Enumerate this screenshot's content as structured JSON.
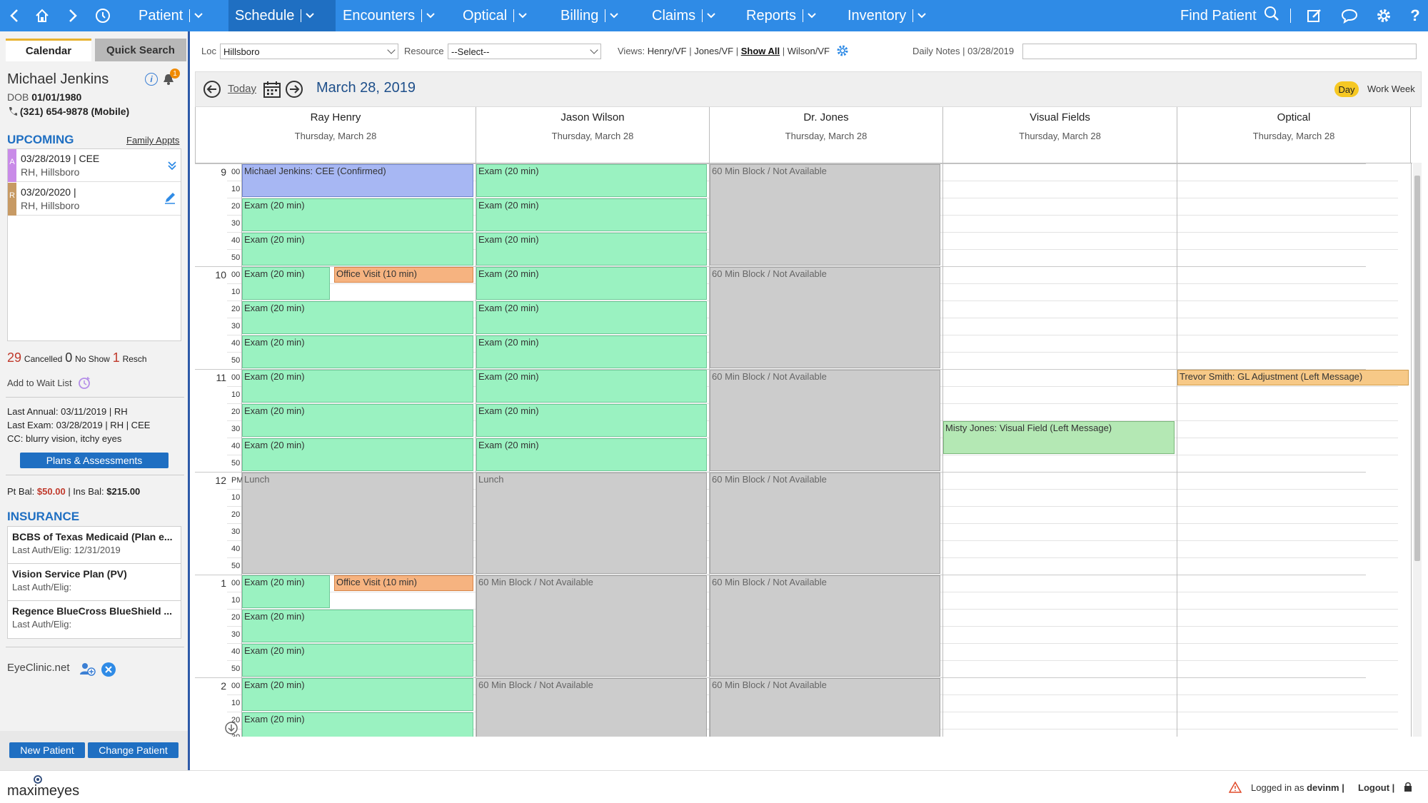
{
  "nav": {
    "items": [
      "Patient",
      "Schedule",
      "Encounters",
      "Optical",
      "Billing",
      "Claims",
      "Reports",
      "Inventory"
    ],
    "find_patient": "Find Patient"
  },
  "left": {
    "tabs": {
      "calendar": "Calendar",
      "quick_search": "Quick Search"
    },
    "patient": {
      "name": "Michael Jenkins",
      "dob_label": "DOB",
      "dob": "01/01/1980",
      "phone": "(321) 654-9878 (Mobile)",
      "badge": "1"
    },
    "upcoming": {
      "title": "UPCOMING",
      "family_link": "Family Appts",
      "appts": [
        {
          "tag": "A",
          "line1": "03/28/2019 | CEE",
          "line2": "RH, Hillsboro",
          "color": "#c98be8"
        },
        {
          "tag": "R",
          "line1": "03/20/2020 |",
          "line2": "RH, Hillsboro",
          "color": "#c79a64"
        }
      ]
    },
    "counts": {
      "cancelled": "29",
      "cancelled_label": "Cancelled",
      "noshow": "0",
      "noshow_label": "No Show",
      "resch": "1",
      "resch_label": "Resch"
    },
    "waitlist": "Add to Wait List",
    "last_annual": "Last Annual: 03/11/2019 | RH",
    "last_exam": "Last Exam: 03/28/2019 | RH | CEE",
    "cc": "CC: blurry vision, itchy eyes",
    "plans_btn": "Plans & Assessments",
    "pt_bal_label": "Pt Bal:",
    "pt_bal": "$50.00",
    "ins_bal_label": "| Ins Bal:",
    "ins_bal": "$215.00",
    "insurance": {
      "title": "INSURANCE",
      "items": [
        {
          "name": "BCBS of Texas Medicaid (Plan e...",
          "auth": "Last Auth/Elig: 12/31/2019"
        },
        {
          "name": "Vision Service Plan (PV)",
          "auth": "Last Auth/Elig:"
        },
        {
          "name": "Regence BlueCross BlueShield ...",
          "auth": "Last Auth/Elig:"
        }
      ]
    },
    "eyeclinic": "EyeClinic.net",
    "new_patient": "New Patient",
    "change_patient": "Change Patient"
  },
  "filter": {
    "loc_label": "Loc",
    "loc_value": "Hillsboro",
    "resource_label": "Resource",
    "resource_value": "--Select--",
    "views_label": "Views:",
    "view_henry": "Henry/VF",
    "view_jones": "Jones/VF",
    "view_showall": "Show All",
    "view_wilson": "Wilson/VF",
    "daily_notes": "Daily Notes | 03/28/2019"
  },
  "calendar": {
    "today": "Today",
    "date": "March 28, 2019",
    "day": "Day",
    "work_week": "Work Week",
    "columns": [
      {
        "name": "Ray Henry",
        "date": "Thursday, March 28"
      },
      {
        "name": "Jason Wilson",
        "date": "Thursday, March 28"
      },
      {
        "name": "Dr. Jones",
        "date": "Thursday, March 28"
      },
      {
        "name": "Visual Fields",
        "date": "Thursday, March 28"
      },
      {
        "name": "Optical",
        "date": "Thursday, March 28"
      }
    ],
    "hours": [
      {
        "h": "9",
        "m": "00"
      },
      {
        "h": "10",
        "m": "00"
      },
      {
        "h": "11",
        "m": "00"
      },
      {
        "h": "12",
        "m": "PM"
      },
      {
        "h": "1",
        "m": "00"
      },
      {
        "h": "2",
        "m": "00"
      }
    ],
    "minute_labels": [
      "10",
      "20",
      "30",
      "40",
      "50"
    ],
    "events": [
      {
        "col": 0,
        "start": 0,
        "dur": 20,
        "text": "Michael Jenkins: CEE (Confirmed)",
        "kind": "conf"
      },
      {
        "col": 0,
        "start": 20,
        "dur": 20,
        "text": "Exam (20 min)",
        "kind": "exam"
      },
      {
        "col": 0,
        "start": 40,
        "dur": 20,
        "text": "Exam (20 min)",
        "kind": "exam"
      },
      {
        "col": 0,
        "start": 60,
        "dur": 20,
        "text": "Exam (20 min)",
        "kind": "exam",
        "half": "left"
      },
      {
        "col": 0,
        "start": 60,
        "dur": 10,
        "text": "Office Visit (10 min)",
        "kind": "ov",
        "half": "right"
      },
      {
        "col": 0,
        "start": 80,
        "dur": 20,
        "text": "Exam (20 min)",
        "kind": "exam"
      },
      {
        "col": 0,
        "start": 100,
        "dur": 20,
        "text": "Exam (20 min)",
        "kind": "exam"
      },
      {
        "col": 0,
        "start": 120,
        "dur": 20,
        "text": "Exam (20 min)",
        "kind": "exam"
      },
      {
        "col": 0,
        "start": 140,
        "dur": 20,
        "text": "Exam (20 min)",
        "kind": "exam"
      },
      {
        "col": 0,
        "start": 160,
        "dur": 20,
        "text": "Exam (20 min)",
        "kind": "exam"
      },
      {
        "col": 0,
        "start": 180,
        "dur": 60,
        "text": "Lunch",
        "kind": "block"
      },
      {
        "col": 0,
        "start": 240,
        "dur": 20,
        "text": "Exam (20 min)",
        "kind": "exam",
        "half": "left"
      },
      {
        "col": 0,
        "start": 240,
        "dur": 10,
        "text": "Office Visit (10 min)",
        "kind": "ov",
        "half": "right"
      },
      {
        "col": 0,
        "start": 260,
        "dur": 20,
        "text": "Exam (20 min)",
        "kind": "exam"
      },
      {
        "col": 0,
        "start": 280,
        "dur": 20,
        "text": "Exam (20 min)",
        "kind": "exam"
      },
      {
        "col": 0,
        "start": 300,
        "dur": 20,
        "text": "Exam (20 min)",
        "kind": "exam"
      },
      {
        "col": 0,
        "start": 320,
        "dur": 20,
        "text": "Exam (20 min)",
        "kind": "exam"
      },
      {
        "col": 1,
        "start": 0,
        "dur": 20,
        "text": "Exam (20 min)",
        "kind": "exam"
      },
      {
        "col": 1,
        "start": 20,
        "dur": 20,
        "text": "Exam (20 min)",
        "kind": "exam"
      },
      {
        "col": 1,
        "start": 40,
        "dur": 20,
        "text": "Exam (20 min)",
        "kind": "exam"
      },
      {
        "col": 1,
        "start": 60,
        "dur": 20,
        "text": "Exam (20 min)",
        "kind": "exam"
      },
      {
        "col": 1,
        "start": 80,
        "dur": 20,
        "text": "Exam (20 min)",
        "kind": "exam"
      },
      {
        "col": 1,
        "start": 100,
        "dur": 20,
        "text": "Exam (20 min)",
        "kind": "exam"
      },
      {
        "col": 1,
        "start": 120,
        "dur": 20,
        "text": "Exam (20 min)",
        "kind": "exam"
      },
      {
        "col": 1,
        "start": 140,
        "dur": 20,
        "text": "Exam (20 min)",
        "kind": "exam"
      },
      {
        "col": 1,
        "start": 160,
        "dur": 20,
        "text": "Exam (20 min)",
        "kind": "exam"
      },
      {
        "col": 1,
        "start": 180,
        "dur": 60,
        "text": "Lunch",
        "kind": "block"
      },
      {
        "col": 1,
        "start": 240,
        "dur": 60,
        "text": "60 Min Block / Not Available",
        "kind": "block"
      },
      {
        "col": 1,
        "start": 300,
        "dur": 60,
        "text": "60 Min Block / Not Available",
        "kind": "block"
      },
      {
        "col": 2,
        "start": 0,
        "dur": 60,
        "text": "60 Min Block / Not Available",
        "kind": "block"
      },
      {
        "col": 2,
        "start": 60,
        "dur": 60,
        "text": "60 Min Block / Not Available",
        "kind": "block"
      },
      {
        "col": 2,
        "start": 120,
        "dur": 60,
        "text": "60 Min Block / Not Available",
        "kind": "block"
      },
      {
        "col": 2,
        "start": 180,
        "dur": 60,
        "text": "60 Min Block / Not Available",
        "kind": "block"
      },
      {
        "col": 2,
        "start": 240,
        "dur": 60,
        "text": "60 Min Block / Not Available",
        "kind": "block"
      },
      {
        "col": 2,
        "start": 300,
        "dur": 60,
        "text": "60 Min Block / Not Available",
        "kind": "block"
      },
      {
        "col": 3,
        "start": 150,
        "dur": 20,
        "text": "Misty Jones: Visual Field (Left Message)",
        "kind": "vf"
      },
      {
        "col": 4,
        "start": 120,
        "dur": 10,
        "text": "Trevor Smith: GL Adjustment (Left Message)",
        "kind": "gl"
      }
    ]
  },
  "footer": {
    "logo": "maximeyes",
    "logged_in_label": "Logged in as",
    "user": "devinm",
    "logout": "Logout"
  }
}
